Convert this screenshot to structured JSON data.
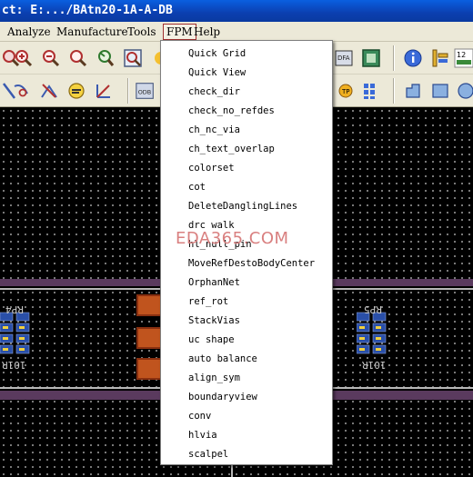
{
  "window": {
    "title": "ct: E:.../BAtn20-1A-A-DB"
  },
  "menubar": {
    "items": [
      {
        "label": "Analyze"
      },
      {
        "label": "Manufacture"
      },
      {
        "label": "Tools"
      },
      {
        "label": "FPM"
      },
      {
        "label": "Help"
      }
    ],
    "active": "FPM"
  },
  "fpm_menu": {
    "items": [
      {
        "label": "Quick Grid"
      },
      {
        "label": "Quick View"
      },
      {
        "label": "check_dir"
      },
      {
        "label": "check_no_refdes"
      },
      {
        "label": "ch_nc_via"
      },
      {
        "label": "ch_text_overlap"
      },
      {
        "label": "colorset"
      },
      {
        "label": "cot"
      },
      {
        "label": "DeleteDanglingLines"
      },
      {
        "label": "drc walk"
      },
      {
        "label": "hl_null_pin"
      },
      {
        "label": "MoveRefDestoBodyCenter"
      },
      {
        "label": "OrphanNet"
      },
      {
        "label": "ref_rot"
      },
      {
        "label": "StackVias"
      },
      {
        "label": "uc shape"
      },
      {
        "label": "auto balance"
      },
      {
        "label": "align_sym"
      },
      {
        "label": "boundaryview"
      },
      {
        "label": "conv"
      },
      {
        "label": "hlvia"
      },
      {
        "label": "scalpel"
      }
    ]
  },
  "canvas": {
    "labels": {
      "left_refdes": "RP4",
      "left_value": "101R",
      "right_refdes": "RP5",
      "right_value": "101R"
    },
    "watermark": "EDA365.COM",
    "colors": {
      "background": "#000000",
      "grid_dot": "#c8c8c8",
      "band": "#5a3a5e",
      "pad_orange": "#c0541e",
      "pad_blue": "#2a4fa8"
    }
  },
  "toolbar": {
    "icons_row1": [
      "zoom-points-icon",
      "zoom-in-icon",
      "zoom-out-icon",
      "zoom-fit-icon",
      "zoom-world-icon",
      "dfa-icon",
      "board-icon",
      "info-icon",
      "measure-icon",
      "grid-icon"
    ],
    "icons_row2": [
      "arc-icon",
      "slide-icon",
      "cross-icon",
      "highlight-icon",
      "angle-icon",
      "odb-icon",
      "testpoint-icon",
      "array-icon",
      "shape-icon",
      "rect-icon",
      "circle-icon"
    ],
    "counter_label": "12"
  }
}
